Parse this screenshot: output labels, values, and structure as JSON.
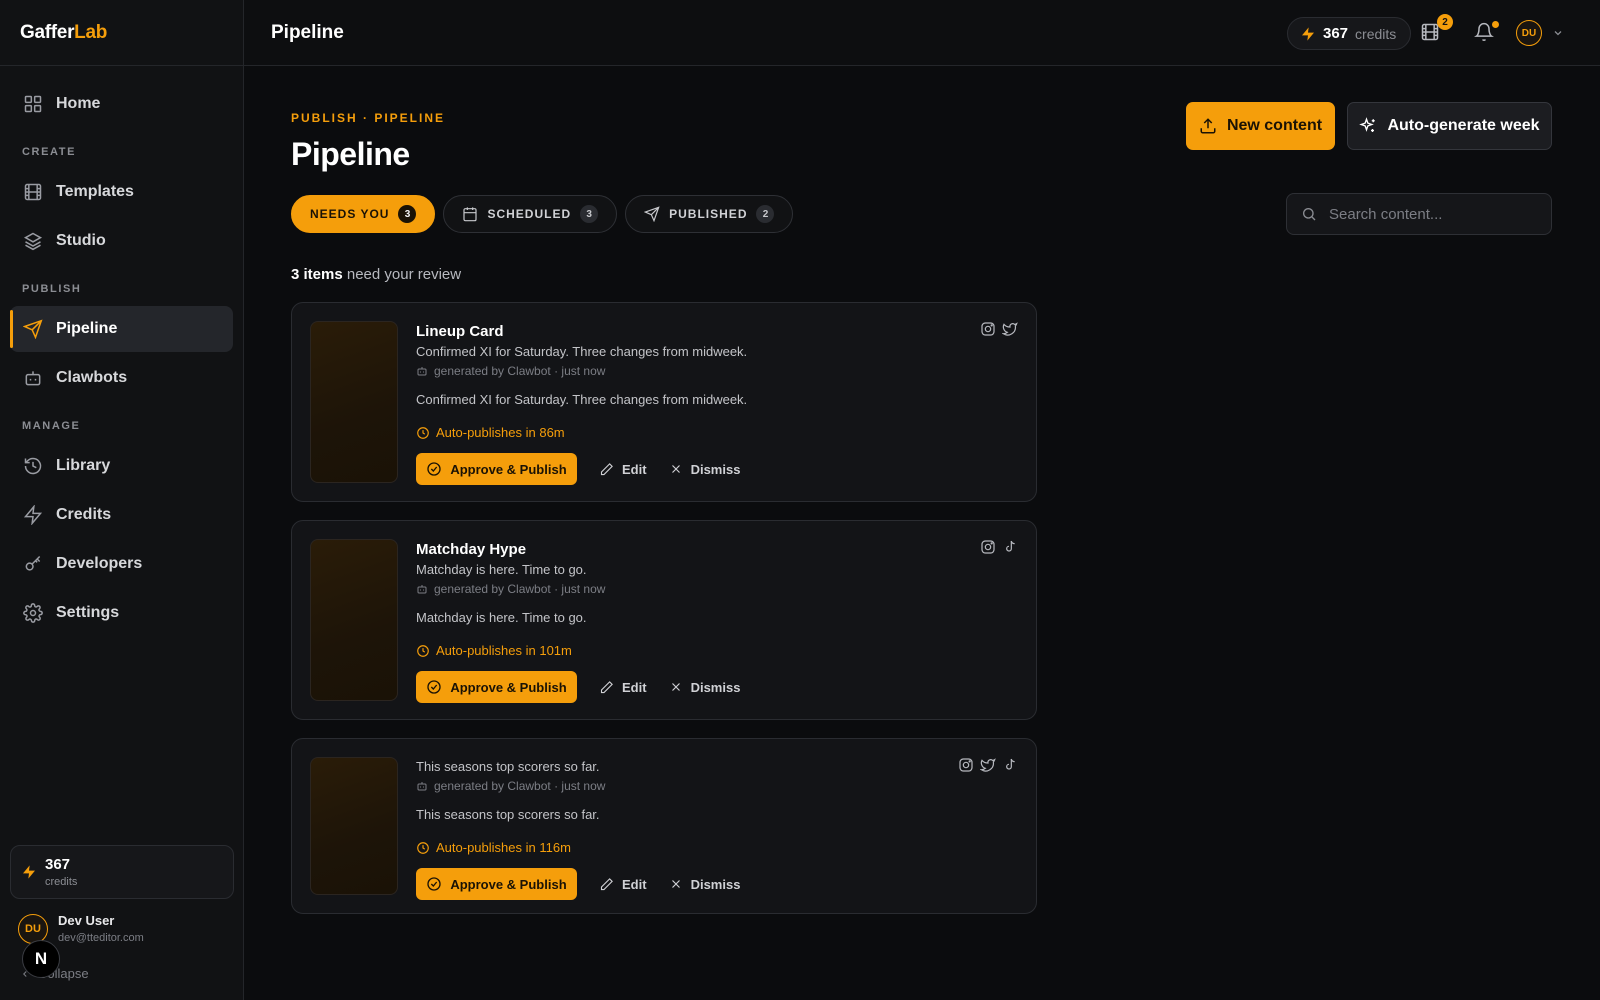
{
  "brand": {
    "part1": "Gaffer",
    "part2": "Lab"
  },
  "sidebar": {
    "home": "Home",
    "section_create": "CREATE",
    "templates": "Templates",
    "studio": "Studio",
    "section_publish": "PUBLISH",
    "pipeline": "Pipeline",
    "clawbots": "Clawbots",
    "section_manage": "MANAGE",
    "library": "Library",
    "credits": "Credits",
    "developers": "Developers",
    "settings": "Settings",
    "credits_count": "367",
    "credits_label": "credits",
    "user_initials": "DU",
    "user_name": "Dev User",
    "user_email": "dev@tteditor.com",
    "collapse": "Collapse",
    "floating_badge": "N"
  },
  "topbar": {
    "title": "Pipeline",
    "credits_count": "367",
    "credits_label": "credits",
    "queue_badge": "2",
    "avatar_initials": "DU"
  },
  "main": {
    "eyebrow": "PUBLISH · PIPELINE",
    "title": "Pipeline",
    "new_content": "New content",
    "auto_generate": "Auto-generate week",
    "search_placeholder": "Search content...",
    "tabs": [
      {
        "label": "NEEDS YOU",
        "count": "3"
      },
      {
        "label": "SCHEDULED",
        "count": "3"
      },
      {
        "label": "PUBLISHED",
        "count": "2"
      }
    ],
    "review_count": "3 items",
    "review_text": " need your review"
  },
  "cards": [
    {
      "title": "Lineup Card",
      "subtitle": "Confirmed XI for Saturday. Three changes from midweek.",
      "generated": "generated by Clawbot · just now",
      "description": "Confirmed XI for Saturday. Three changes from midweek.",
      "auto_publish": "Auto-publishes in 86m",
      "approve": "Approve & Publish",
      "edit": "Edit",
      "dismiss": "Dismiss",
      "platforms": [
        "instagram-icon",
        "twitter-icon"
      ]
    },
    {
      "title": "Matchday Hype",
      "subtitle": "Matchday is here. Time to go.",
      "generated": "generated by Clawbot · just now",
      "description": "Matchday is here. Time to go.",
      "auto_publish": "Auto-publishes in 101m",
      "approve": "Approve & Publish",
      "edit": "Edit",
      "dismiss": "Dismiss",
      "platforms": [
        "instagram-icon",
        "tiktok-icon"
      ]
    },
    {
      "title": "",
      "subtitle": "This seasons top scorers so far.",
      "generated": "generated by Clawbot · just now",
      "description": "This seasons top scorers so far.",
      "auto_publish": "Auto-publishes in 116m",
      "approve": "Approve & Publish",
      "edit": "Edit",
      "dismiss": "Dismiss",
      "platforms": [
        "instagram-icon",
        "twitter-icon",
        "tiktok-icon"
      ]
    }
  ],
  "colors": {
    "accent": "#f59e0b",
    "background": "#0b0c0e",
    "sidebar": "#111214"
  }
}
